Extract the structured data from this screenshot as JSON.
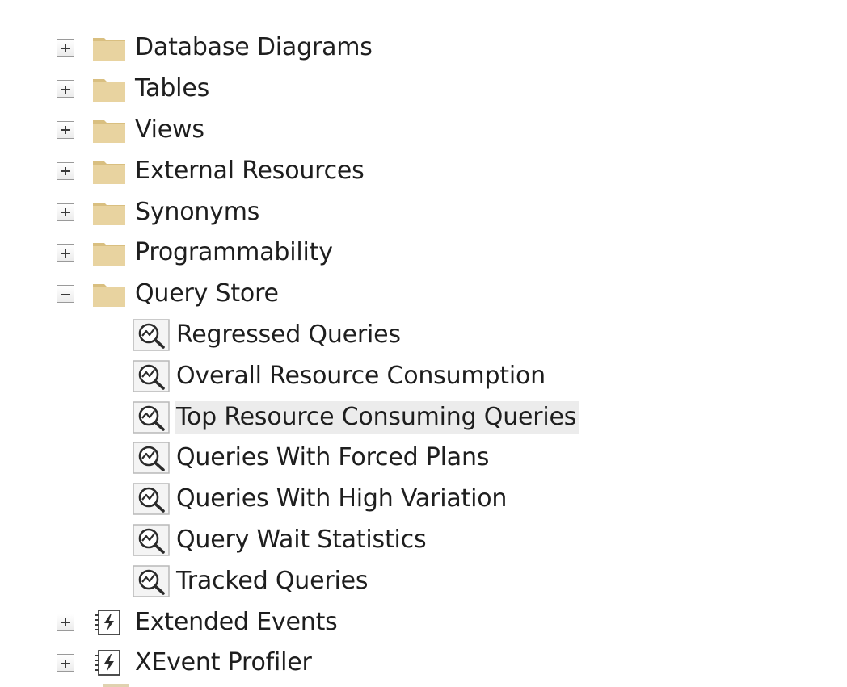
{
  "tree": {
    "items": [
      {
        "label": "Database Diagrams",
        "icon": "folder-icon",
        "expanded": false
      },
      {
        "label": "Tables",
        "icon": "folder-icon",
        "expanded": false
      },
      {
        "label": "Views",
        "icon": "folder-icon",
        "expanded": false
      },
      {
        "label": "External Resources",
        "icon": "folder-icon",
        "expanded": false
      },
      {
        "label": "Synonyms",
        "icon": "folder-icon",
        "expanded": false
      },
      {
        "label": "Programmability",
        "icon": "folder-icon",
        "expanded": false
      },
      {
        "label": "Query Store",
        "icon": "folder-icon",
        "expanded": true,
        "children": [
          {
            "label": "Regressed Queries",
            "icon": "report-icon"
          },
          {
            "label": "Overall Resource Consumption",
            "icon": "report-icon"
          },
          {
            "label": "Top Resource Consuming Queries",
            "icon": "report-icon",
            "selected": true
          },
          {
            "label": "Queries With Forced Plans",
            "icon": "report-icon"
          },
          {
            "label": "Queries With High Variation",
            "icon": "report-icon"
          },
          {
            "label": "Query Wait Statistics",
            "icon": "report-icon"
          },
          {
            "label": "Tracked Queries",
            "icon": "report-icon"
          }
        ]
      },
      {
        "label": "Extended Events",
        "icon": "extended-events-icon",
        "expanded": false
      },
      {
        "label": "XEvent Profiler",
        "icon": "extended-events-icon",
        "expanded": false
      }
    ]
  },
  "colors": {
    "folder": "#e6cf9a",
    "folder_dark": "#d7bb7c",
    "selection": "#ececec",
    "text": "#1e1e1e"
  }
}
